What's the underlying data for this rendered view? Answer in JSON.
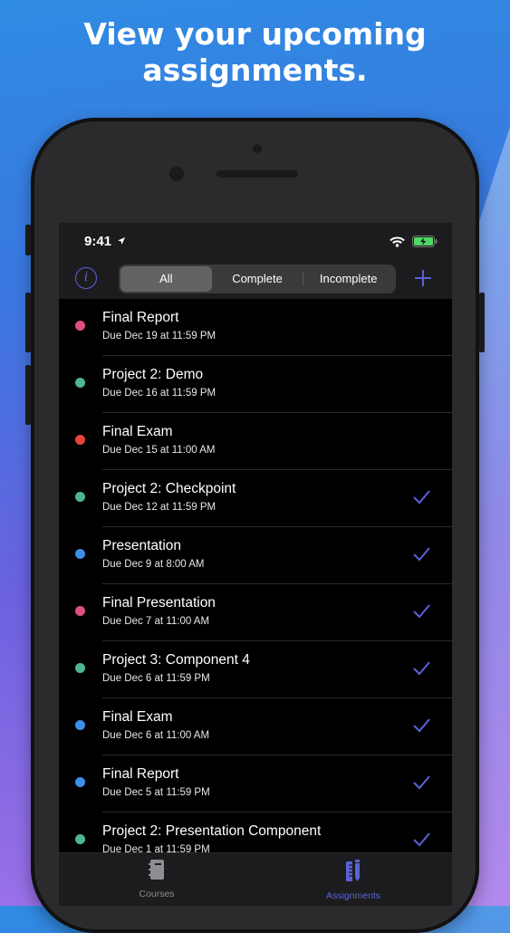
{
  "headline": {
    "line1": "View your upcoming",
    "line2": "assignments."
  },
  "status": {
    "time": "9:41"
  },
  "toolbar": {
    "info_icon": "info-icon",
    "segments": [
      "All",
      "Complete",
      "Incomplete"
    ],
    "selected_segment": "All",
    "add_icon": "plus-icon"
  },
  "colors": {
    "accent": "#5b62d8",
    "pink": "#e0507f",
    "teal": "#4fb593",
    "red": "#e5453a",
    "blue": "#3e8ee8"
  },
  "assignments": [
    {
      "title": "Final Report",
      "due": "Due Dec 19 at 11:59 PM",
      "color": "#e0507f",
      "completed": false
    },
    {
      "title": "Project 2: Demo",
      "due": "Due Dec 16 at 11:59 PM",
      "color": "#4fb593",
      "completed": false
    },
    {
      "title": "Final Exam",
      "due": "Due Dec 15 at 11:00 AM",
      "color": "#e5453a",
      "completed": false
    },
    {
      "title": "Project 2: Checkpoint",
      "due": "Due Dec 12 at 11:59 PM",
      "color": "#4fb593",
      "completed": true
    },
    {
      "title": "Presentation",
      "due": "Due Dec 9 at 8:00 AM",
      "color": "#3e8ee8",
      "completed": true
    },
    {
      "title": "Final Presentation",
      "due": "Due Dec 7 at 11:00 AM",
      "color": "#e0507f",
      "completed": true
    },
    {
      "title": "Project 3: Component 4",
      "due": "Due Dec 6 at 11:59 PM",
      "color": "#4fb593",
      "completed": true
    },
    {
      "title": "Final Exam",
      "due": "Due Dec 6 at 11:00 AM",
      "color": "#3e8ee8",
      "completed": true
    },
    {
      "title": "Final Report",
      "due": "Due Dec 5 at 11:59 PM",
      "color": "#3e8ee8",
      "completed": true
    },
    {
      "title": "Project 2: Presentation Component",
      "due": "Due Dec 1 at 11:59 PM",
      "color": "#4fb593",
      "completed": true
    }
  ],
  "tabbar": {
    "tabs": [
      {
        "label": "Courses",
        "icon": "notebook-icon",
        "active": false
      },
      {
        "label": "Assignments",
        "icon": "ruler-pencil-icon",
        "active": true
      }
    ]
  }
}
